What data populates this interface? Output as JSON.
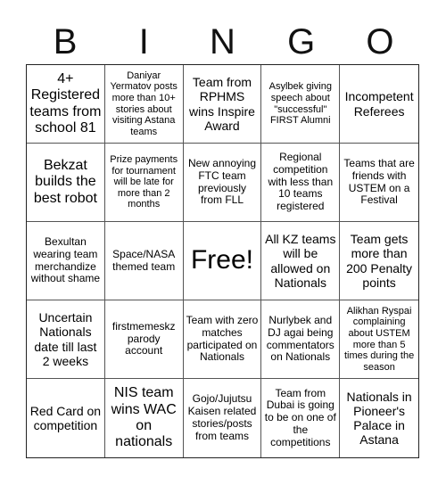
{
  "header": {
    "letters": [
      "B",
      "I",
      "N",
      "G",
      "O"
    ]
  },
  "cells": [
    {
      "text": "4+ Registered teams from school 81",
      "size": "l"
    },
    {
      "text": "Daniyar Yermatov posts more than 10+ stories about visiting Astana teams",
      "size": "xs"
    },
    {
      "text": "Team from RPHMS wins Inspire Award",
      "size": "m"
    },
    {
      "text": "Asylbek giving speech about \"successful\" FIRST Alumni",
      "size": "xs"
    },
    {
      "text": "Incompetent Referees",
      "size": "m"
    },
    {
      "text": "Bekzat builds the best robot",
      "size": "l"
    },
    {
      "text": "Prize payments for tournament will be late for more than 2 months",
      "size": "xs"
    },
    {
      "text": "New annoying FTC team previously from FLL",
      "size": "s"
    },
    {
      "text": "Regional competition with less than 10 teams registered",
      "size": "s"
    },
    {
      "text": "Teams that are friends with USTEM on a Festival",
      "size": "s"
    },
    {
      "text": "Bexultan wearing team merchandize without shame",
      "size": "s"
    },
    {
      "text": "Space/NASA themed team",
      "size": "s"
    },
    {
      "text": "Free!",
      "size": "xl"
    },
    {
      "text": "All KZ teams will be allowed on Nationals",
      "size": "m"
    },
    {
      "text": "Team gets more than 200 Penalty points",
      "size": "m"
    },
    {
      "text": "Uncertain Nationals date till last 2 weeks",
      "size": "m"
    },
    {
      "text": "firstmemeskz parody account",
      "size": "s"
    },
    {
      "text": "Team with zero matches participated on Nationals",
      "size": "s"
    },
    {
      "text": "Nurlybek and DJ agai being commentators on Nationals",
      "size": "s"
    },
    {
      "text": "Alikhan Ryspai complaining about USTEM more than 5 times during the season",
      "size": "xs"
    },
    {
      "text": "Red Card on competition",
      "size": "m"
    },
    {
      "text": "NIS team wins WAC on nationals",
      "size": "l"
    },
    {
      "text": "Gojo/Jujutsu Kaisen related stories/posts from teams",
      "size": "s"
    },
    {
      "text": "Team from Dubai is going to be on one of the competitions",
      "size": "s"
    },
    {
      "text": "Nationals in Pioneer's Palace in Astana",
      "size": "m"
    }
  ]
}
